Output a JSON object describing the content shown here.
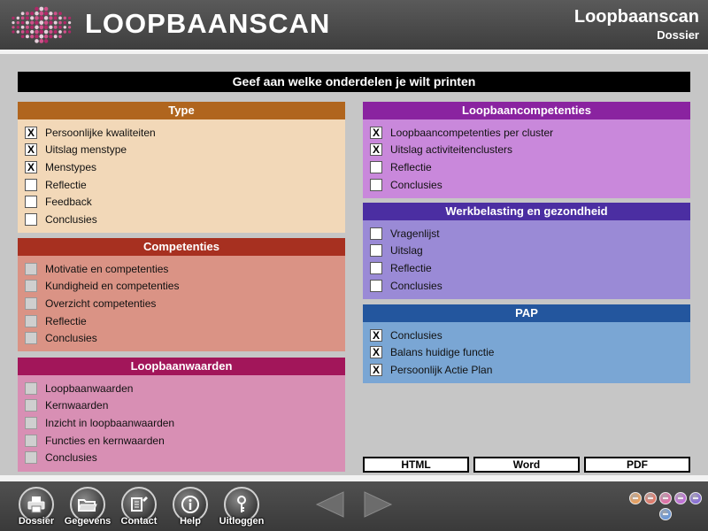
{
  "header": {
    "app_title": "LOOPBAANSCAN",
    "right_title": "Loopbaanscan",
    "right_subtitle": "Dossier"
  },
  "banner": "Geef aan welke onderdelen je wilt printen",
  "panels": {
    "type": {
      "title": "Type",
      "header_color": "#b0651e",
      "items": [
        {
          "label": "Persoonlijke kwaliteiten",
          "checked": true,
          "enabled": true
        },
        {
          "label": "Uitslag menstype",
          "checked": true,
          "enabled": true
        },
        {
          "label": "Menstypes",
          "checked": true,
          "enabled": true
        },
        {
          "label": "Reflectie",
          "checked": false,
          "enabled": true
        },
        {
          "label": "Feedback",
          "checked": false,
          "enabled": true
        },
        {
          "label": "Conclusies",
          "checked": false,
          "enabled": true
        }
      ]
    },
    "competenties": {
      "title": "Competenties",
      "header_color": "#a73020",
      "items": [
        {
          "label": "Motivatie en competenties",
          "checked": false,
          "enabled": false
        },
        {
          "label": "Kundigheid en competenties",
          "checked": false,
          "enabled": false
        },
        {
          "label": "Overzicht competenties",
          "checked": false,
          "enabled": false
        },
        {
          "label": "Reflectie",
          "checked": false,
          "enabled": false
        },
        {
          "label": "Conclusies",
          "checked": false,
          "enabled": false
        }
      ]
    },
    "loopbaanwaarden": {
      "title": "Loopbaanwaarden",
      "header_color": "#a2165a",
      "items": [
        {
          "label": "Loopbaanwaarden",
          "checked": false,
          "enabled": false
        },
        {
          "label": "Kernwaarden",
          "checked": false,
          "enabled": false
        },
        {
          "label": "Inzicht in loopbaanwaarden",
          "checked": false,
          "enabled": false
        },
        {
          "label": "Functies en kernwaarden",
          "checked": false,
          "enabled": false
        },
        {
          "label": "Conclusies",
          "checked": false,
          "enabled": false
        }
      ]
    },
    "loopbaancompetenties": {
      "title": "Loopbaancompetenties",
      "header_color": "#8a23a0",
      "items": [
        {
          "label": "Loopbaancompetenties per cluster",
          "checked": true,
          "enabled": true
        },
        {
          "label": "Uitslag activiteitenclusters",
          "checked": true,
          "enabled": true
        },
        {
          "label": "Reflectie",
          "checked": false,
          "enabled": true
        },
        {
          "label": "Conclusies",
          "checked": false,
          "enabled": true
        }
      ]
    },
    "werkbelasting": {
      "title": "Werkbelasting en gezondheid",
      "header_color": "#4b2ea2",
      "items": [
        {
          "label": "Vragenlijst",
          "checked": false,
          "enabled": true
        },
        {
          "label": "Uitslag",
          "checked": false,
          "enabled": true
        },
        {
          "label": "Reflectie",
          "checked": false,
          "enabled": true
        },
        {
          "label": "Conclusies",
          "checked": false,
          "enabled": true
        }
      ]
    },
    "pap": {
      "title": "PAP",
      "header_color": "#23569e",
      "items": [
        {
          "label": "Conclusies",
          "checked": true,
          "enabled": true
        },
        {
          "label": "Balans huidige functie",
          "checked": true,
          "enabled": true
        },
        {
          "label": "Persoonlijk Actie Plan",
          "checked": true,
          "enabled": true
        }
      ]
    }
  },
  "check_mark": "X",
  "export": {
    "html_label": "HTML",
    "word_label": "Word",
    "pdf_label": "PDF"
  },
  "footer": {
    "nav": [
      {
        "label": "Dossier",
        "icon": "printer-icon"
      },
      {
        "label": "Gegevens",
        "icon": "folder-icon"
      },
      {
        "label": "Contact",
        "icon": "contact-icon"
      },
      {
        "label": "Help",
        "icon": "info-icon"
      },
      {
        "label": "Uitloggen",
        "icon": "key-icon"
      }
    ],
    "module_colors": [
      "#e8a060",
      "#e07a6a",
      "#e070a8",
      "#c070d8",
      "#8a70d8",
      "#6a98d8"
    ]
  }
}
